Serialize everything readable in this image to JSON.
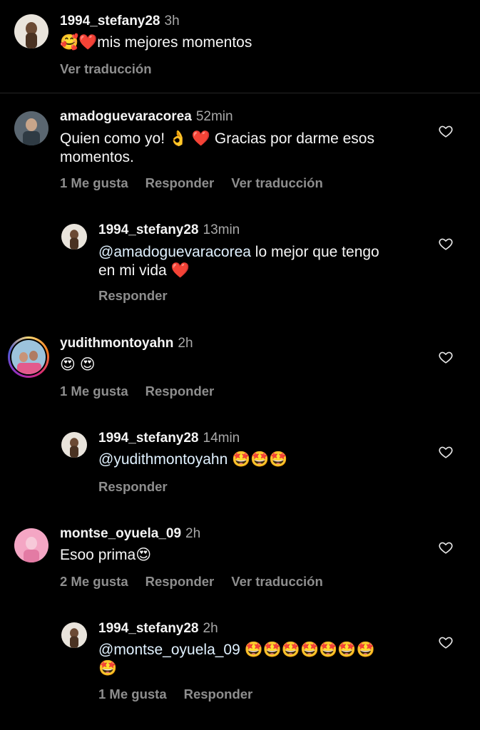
{
  "caption": {
    "username": "1994_stefany28",
    "time": "3h",
    "text": "🥰❤️mis mejores momentos",
    "translate": "Ver traducción"
  },
  "comments": [
    {
      "username": "amadoguevaracorea",
      "time": "52min",
      "line1": "Quien como yo! 👌 ❤️ Gracias por darme esos",
      "line2": "momentos.",
      "likes": "1 Me gusta",
      "reply": "Responder",
      "translate": "Ver traducción"
    },
    {
      "username": "1994_stefany28",
      "time": "13min",
      "mention": "@amadoguevaracorea",
      "line1_rest": " lo mejor que tengo",
      "line2": "en mi vida ❤️",
      "reply": "Responder"
    },
    {
      "username": "yudithmontoyahn",
      "time": "2h",
      "text": "😍 😍",
      "likes": "1 Me gusta",
      "reply": "Responder"
    },
    {
      "username": "1994_stefany28",
      "time": "14min",
      "mention": "@yudithmontoyahn",
      "rest": " 🤩🤩🤩",
      "reply": "Responder"
    },
    {
      "username": "montse_oyuela_09",
      "time": "2h",
      "text": "Esoo prima😍",
      "likes": "2 Me gusta",
      "reply": "Responder",
      "translate": "Ver traducción"
    },
    {
      "username": "1994_stefany28",
      "time": "2h",
      "mention": "@montse_oyuela_09",
      "rest": " 🤩🤩🤩🤩🤩🤩🤩",
      "line2": "🤩",
      "likes": "1 Me gusta",
      "reply": "Responder"
    }
  ],
  "icons": {
    "like": "heart-outline-icon"
  },
  "colors": {
    "background": "#000000",
    "text": "#f5f5f5",
    "muted": "#8e8e8e",
    "mention": "#e0f1ff",
    "story_ring": "#d62976"
  }
}
